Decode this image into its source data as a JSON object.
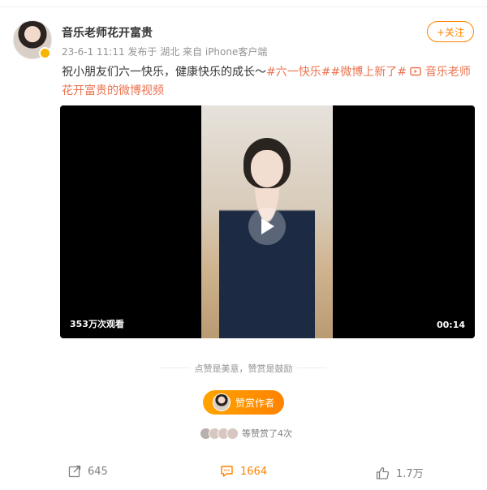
{
  "post": {
    "author": "音乐老师花开富贵",
    "meta": "23-6-1 11:11  发布于 湖北  来自 iPhone客户端",
    "follow_label": "+关注",
    "content_text": "祝小朋友们六一快乐，健康快乐的成长～",
    "hashtags": [
      "#六一快乐#",
      "#微博上新了#"
    ],
    "video_link": "音乐老师花开富贵的微博视频"
  },
  "video": {
    "views": "353万次观看",
    "duration": "00:14"
  },
  "reward": {
    "tagline": "点赞是美意，赞赏是鼓励",
    "button": "赞赏作者",
    "count_text": "等赞赏了4次"
  },
  "actions": {
    "repost": "645",
    "comment": "1664",
    "like": "1.7万"
  },
  "colors": {
    "accent": "#ff8200",
    "link": "#eb7350",
    "muted": "#939393"
  }
}
